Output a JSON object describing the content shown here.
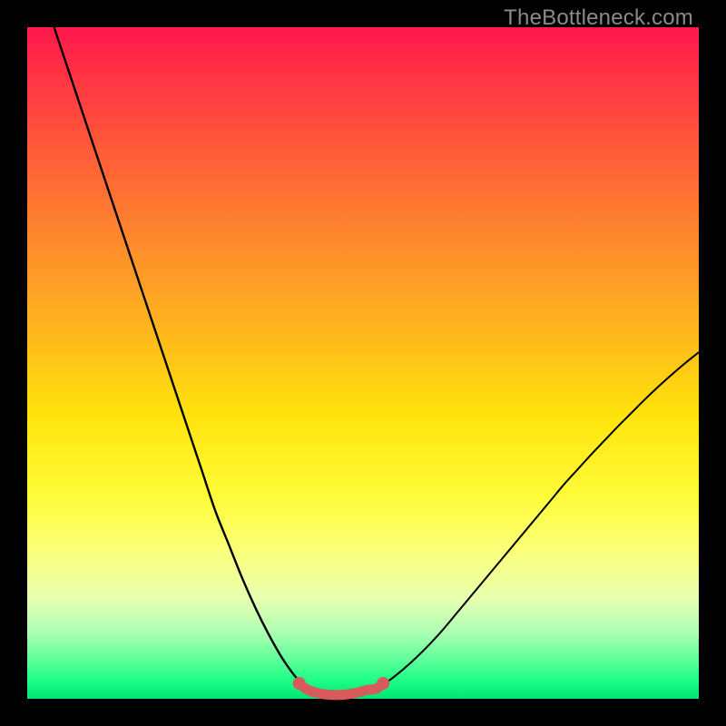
{
  "watermark": "TheBottleneck.com",
  "colors": {
    "page_bg": "#000000",
    "curve_stroke": "#000000",
    "highlight_stroke": "#d85a5a",
    "highlight_endcap": "#d85a5a"
  },
  "chart_data": {
    "type": "line",
    "title": "",
    "xlabel": "",
    "ylabel": "",
    "xlim": [
      0,
      100
    ],
    "ylim": [
      0,
      100
    ],
    "series": [
      {
        "name": "left-branch",
        "x": [
          4,
          6,
          8,
          10,
          12,
          14,
          16,
          18,
          20,
          22,
          24,
          26,
          28,
          30,
          32,
          34,
          36,
          38,
          40,
          41.5
        ],
        "values": [
          100,
          94,
          88,
          82,
          76,
          70,
          64,
          58,
          52,
          46,
          40,
          34,
          28,
          23,
          18,
          13.5,
          9.5,
          6,
          3.2,
          1.5
        ]
      },
      {
        "name": "right-branch",
        "x": [
          52,
          54,
          56,
          58,
          60,
          62,
          64,
          66,
          68,
          70,
          72,
          74,
          76,
          78,
          80,
          82,
          84,
          86,
          88,
          90,
          92,
          94,
          96,
          98,
          100
        ],
        "values": [
          1.5,
          2.8,
          4.4,
          6.2,
          8.2,
          10.4,
          12.8,
          15.2,
          17.6,
          20.0,
          22.4,
          24.8,
          27.2,
          29.6,
          32.0,
          34.2,
          36.4,
          38.5,
          40.6,
          42.6,
          44.6,
          46.5,
          48.3,
          50.0,
          51.6
        ]
      },
      {
        "name": "valley-highlight",
        "x": [
          40.5,
          41.5,
          43,
          45,
          47,
          49,
          50.5,
          52,
          53
        ],
        "values": [
          2.3,
          1.5,
          0.9,
          0.6,
          0.6,
          0.9,
          1.3,
          1.5,
          2.3
        ]
      }
    ],
    "annotations": []
  }
}
